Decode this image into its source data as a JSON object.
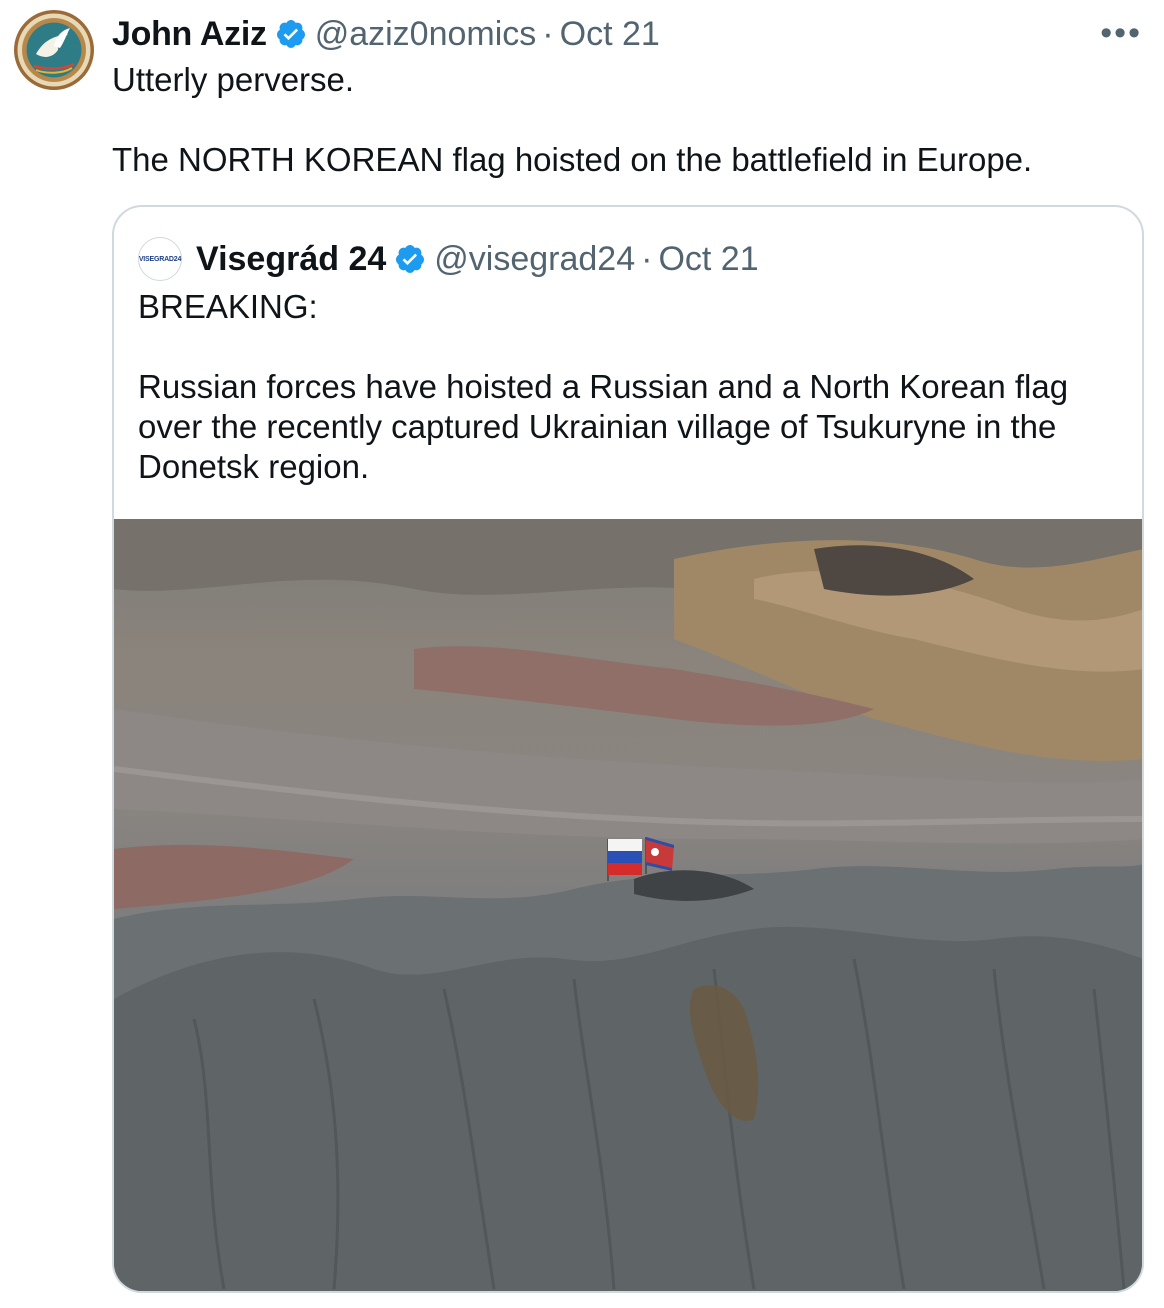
{
  "tweet": {
    "author_name": "John Aziz",
    "author_handle": "@aziz0nomics",
    "date": "Oct 21",
    "verified_icon": "verified-badge-icon",
    "more_label": "•••",
    "paragraphs": [
      "Utterly perverse.",
      "The NORTH KOREAN flag hoisted on the battlefield in Europe."
    ]
  },
  "quoted_tweet": {
    "author_name": "Visegrád 24",
    "author_handle": "@visegrad24",
    "date": "Oct 21",
    "avatar_text": "VISEGRAD24",
    "paragraphs": [
      "BREAKING:",
      "Russian forces have hoisted a Russian and a North Korean flag over the recently captured Ukrainian village of Tsukuryne in the Donetsk region."
    ]
  },
  "colors": {
    "verified": "#1d9bf0",
    "secondary_text": "#536471",
    "border": "#cfd9de"
  }
}
